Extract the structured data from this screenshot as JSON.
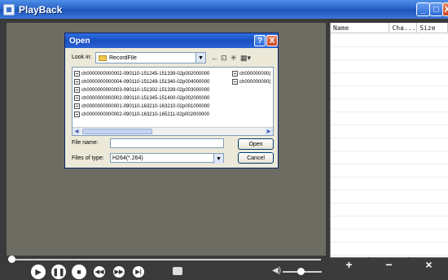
{
  "window": {
    "title": "PlayBack",
    "min_glyph": "_",
    "max_glyph": "□",
    "close_glyph": "X"
  },
  "file_panel": {
    "columns": [
      "Name",
      "Cha...",
      "Size"
    ]
  },
  "panel_buttons": {
    "add": "+",
    "remove": "−",
    "clear": "×"
  },
  "controls": {
    "play": "▶",
    "pause": "❚❚",
    "stop": "■",
    "rewind": "◀◀",
    "forward": "▶▶",
    "step": "▶|",
    "volume_icon": "◀)"
  },
  "dialog": {
    "title": "Open",
    "help_glyph": "?",
    "close_glyph": "X",
    "look_in_label": "Look in:",
    "look_in_value": "RecordFile",
    "dropdown_arrow": "▼",
    "toolbar": {
      "back": "←",
      "up": "⊡",
      "new_folder": "✳",
      "view": "▦▾"
    },
    "files": [
      "ch0000000000002-090110-151245-151339-02p002000000",
      "ch0000000000004-090110-151249-151340-02p004000000",
      "ch0000000000003-090110-151302-151339-02p003000000",
      "ch0000000000002-090110-151345-151400-02p002000000",
      "ch0000000000001-090110-163210-163210-02p001000000",
      "ch0000000000002-090110-163210-165211-02p002000000",
      "ch000000000(",
      "ch000000000("
    ],
    "scroll_left": "◀",
    "scroll_right": "▶",
    "file_name_label": "File name:",
    "file_name_value": "",
    "file_type_label": "Files of type:",
    "file_type_value": "H264(*.264)",
    "open_button": "Open",
    "cancel_button": "Cancel"
  }
}
